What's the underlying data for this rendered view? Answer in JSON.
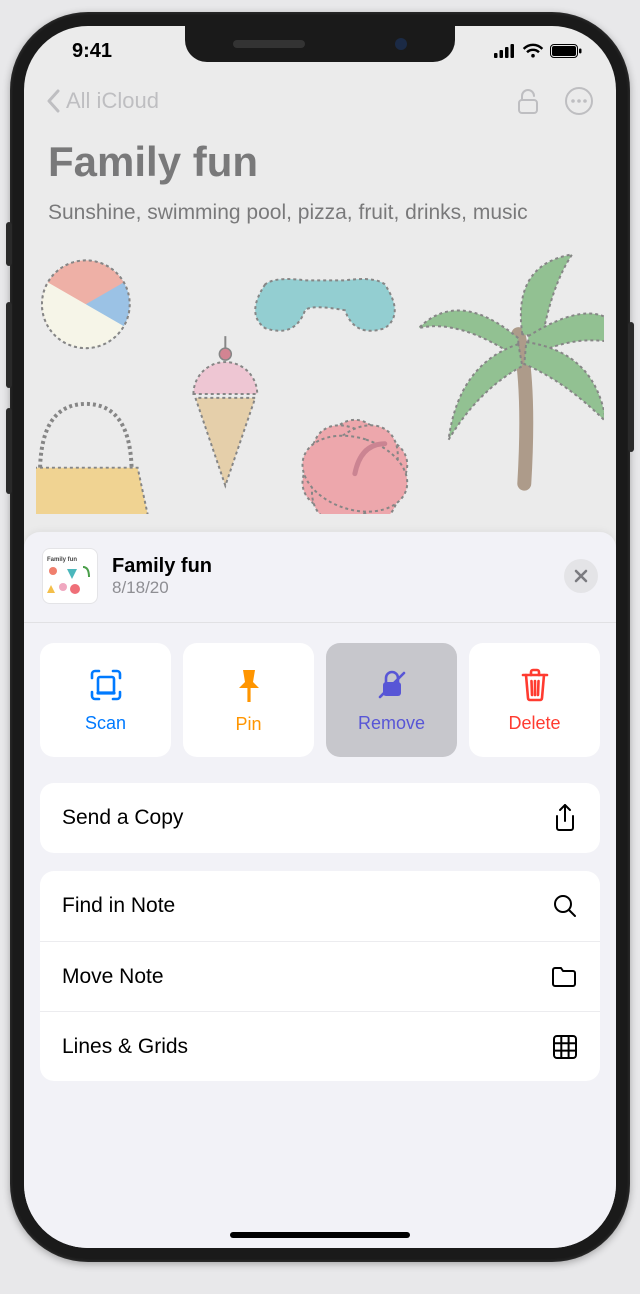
{
  "status": {
    "time": "9:41"
  },
  "nav": {
    "back": "All iCloud"
  },
  "note": {
    "title": "Family fun",
    "body": "Sunshine, swimming pool, pizza, fruit, drinks, music"
  },
  "sheet": {
    "title": "Family fun",
    "date": "8/18/20",
    "tiles": {
      "scan": {
        "label": "Scan"
      },
      "pin": {
        "label": "Pin"
      },
      "remove": {
        "label": "Remove"
      },
      "delete": {
        "label": "Delete"
      }
    },
    "rows": {
      "send": {
        "label": "Send a Copy"
      },
      "find": {
        "label": "Find in Note"
      },
      "move": {
        "label": "Move Note"
      },
      "lines": {
        "label": "Lines & Grids"
      }
    }
  }
}
